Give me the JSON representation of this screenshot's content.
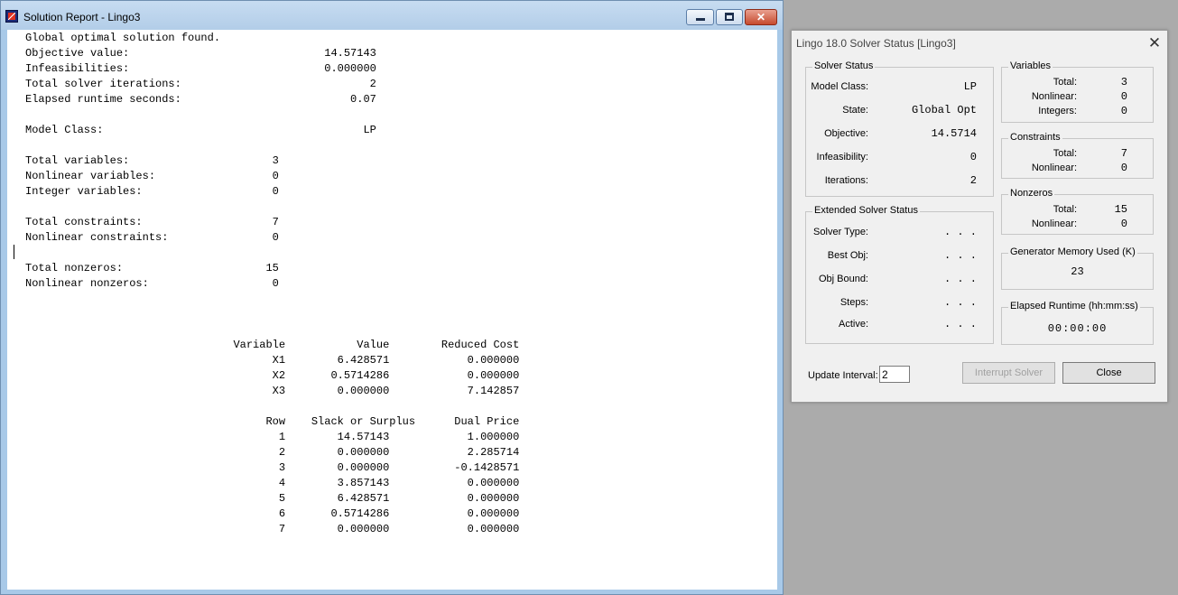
{
  "report_window": {
    "title": "Solution Report - Lingo3",
    "report_text": "Global optimal solution found.\nObjective value:                              14.57143\nInfeasibilities:                              0.000000\nTotal solver iterations:                             2\nElapsed runtime seconds:                          0.07\n\nModel Class:                                        LP\n\nTotal variables:                      3\nNonlinear variables:                  0\nInteger variables:                    0\n\nTotal constraints:                    7\nNonlinear constraints:                0\n\nTotal nonzeros:                      15\nNonlinear nonzeros:                   0\n\n\n\n                                Variable           Value        Reduced Cost\n                                      X1        6.428571            0.000000\n                                      X2       0.5714286            0.000000\n                                      X3        0.000000            7.142857\n\n                                     Row    Slack or Surplus      Dual Price\n                                       1        14.57143            1.000000\n                                       2        0.000000            2.285714\n                                       3        0.000000          -0.1428571\n                                       4        3.857143            0.000000\n                                       5        6.428571            0.000000\n                                       6       0.5714286            0.000000\n                                       7        0.000000            0.000000"
  },
  "status_dialog": {
    "title": "Lingo 18.0 Solver Status [Lingo3]",
    "solver_status": {
      "legend": "Solver Status",
      "model_class_label": "Model Class:",
      "model_class": "LP",
      "state_label": "State:",
      "state": "Global Opt",
      "objective_label": "Objective:",
      "objective": "14.5714",
      "infeasibility_label": "Infeasibility:",
      "infeasibility": "0",
      "iterations_label": "Iterations:",
      "iterations": "2"
    },
    "extended_status": {
      "legend": "Extended Solver Status",
      "solver_type_label": "Solver Type:",
      "solver_type": ". . .",
      "best_obj_label": "Best Obj:",
      "best_obj": ". . .",
      "obj_bound_label": "Obj Bound:",
      "obj_bound": ". . .",
      "steps_label": "Steps:",
      "steps": ". . .",
      "active_label": "Active:",
      "active": ". . ."
    },
    "variables": {
      "legend": "Variables",
      "total_label": "Total:",
      "total": "3",
      "nonlinear_label": "Nonlinear:",
      "nonlinear": "0",
      "integers_label": "Integers:",
      "integers": "0"
    },
    "constraints": {
      "legend": "Constraints",
      "total_label": "Total:",
      "total": "7",
      "nonlinear_label": "Nonlinear:",
      "nonlinear": "0"
    },
    "nonzeros": {
      "legend": "Nonzeros",
      "total_label": "Total:",
      "total": "15",
      "nonlinear_label": "Nonlinear:",
      "nonlinear": "0"
    },
    "memory": {
      "legend": "Generator Memory Used (K)",
      "value": "23"
    },
    "runtime": {
      "legend": "Elapsed Runtime (hh:mm:ss)",
      "value": "00:00:00"
    },
    "update_interval_label": "Update Interval:",
    "update_interval": "2",
    "interrupt_label": "Interrupt Solver",
    "close_label": "Close"
  }
}
